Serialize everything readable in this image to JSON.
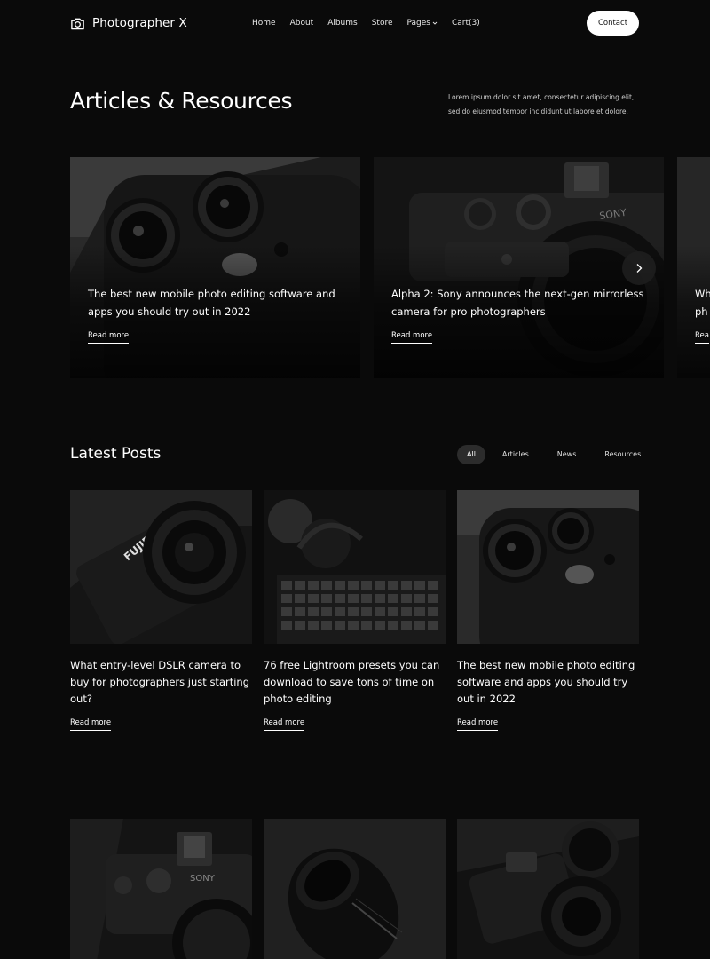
{
  "header": {
    "logo_icon": "camera-icon",
    "brand": "Photographer X",
    "nav": [
      {
        "label": "Home"
      },
      {
        "label": "About"
      },
      {
        "label": "Albums"
      },
      {
        "label": "Store"
      },
      {
        "label": "Pages"
      },
      {
        "label": "Cart(3)"
      }
    ],
    "contact_label": "Contact"
  },
  "hero": {
    "title": "Articles & Resources",
    "description": "Lorem ipsum dolor sit amet, consectetur adipiscing elit, sed do eiusmod tempor incididunt ut labore et dolore."
  },
  "slider": {
    "slides": [
      {
        "title": "The best new mobile photo editing software and apps you should try out in 2022",
        "read_more": "Read more"
      },
      {
        "title": "Alpha 2: Sony announces the next-gen mirrorless camera for pro photographers",
        "read_more": "Read more"
      },
      {
        "title": "Wh ph",
        "read_more": "Rea"
      }
    ],
    "next_icon": "chevron-right-icon"
  },
  "latest": {
    "title": "Latest Posts",
    "filters": [
      "All",
      "Articles",
      "News",
      "Resources"
    ],
    "active_filter": "All",
    "posts": [
      {
        "title": "What entry-level DSLR camera to buy for photographers just starting out?",
        "read_more": "Read more"
      },
      {
        "title": "76 free Lightroom presets you can download to save tons of time on photo editing",
        "read_more": "Read more"
      },
      {
        "title": "The best new mobile photo editing software and apps you should try out in 2022",
        "read_more": "Read more"
      }
    ]
  },
  "colors": {
    "background": "#0a0a0a",
    "text": "#ffffff",
    "button_bg": "#ffffff",
    "active_filter_bg": "#2c2c2c"
  }
}
